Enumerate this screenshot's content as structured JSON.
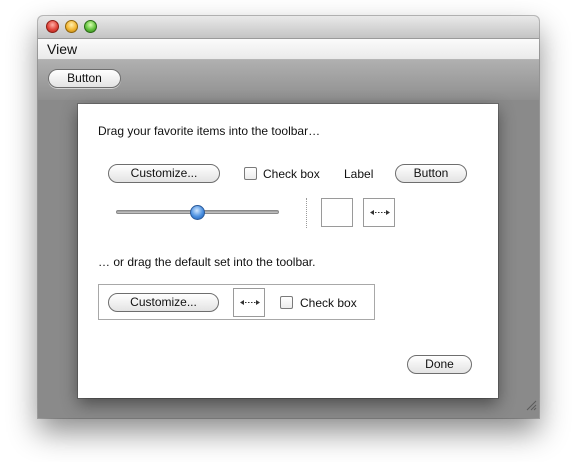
{
  "window": {
    "menu": {
      "view_label": "View"
    },
    "toolbar": {
      "button_label": "Button"
    }
  },
  "sheet": {
    "intro_text": "Drag your favorite items into the toolbar…",
    "items": {
      "customize_label": "Customize...",
      "checkbox_label": "Check box",
      "label_text": "Label",
      "button_label": "Button",
      "slider_value": 0.5
    },
    "default_text": "… or drag the default set into the toolbar.",
    "default_set": {
      "customize_label": "Customize...",
      "checkbox_label": "Check box"
    },
    "done_label": "Done"
  }
}
